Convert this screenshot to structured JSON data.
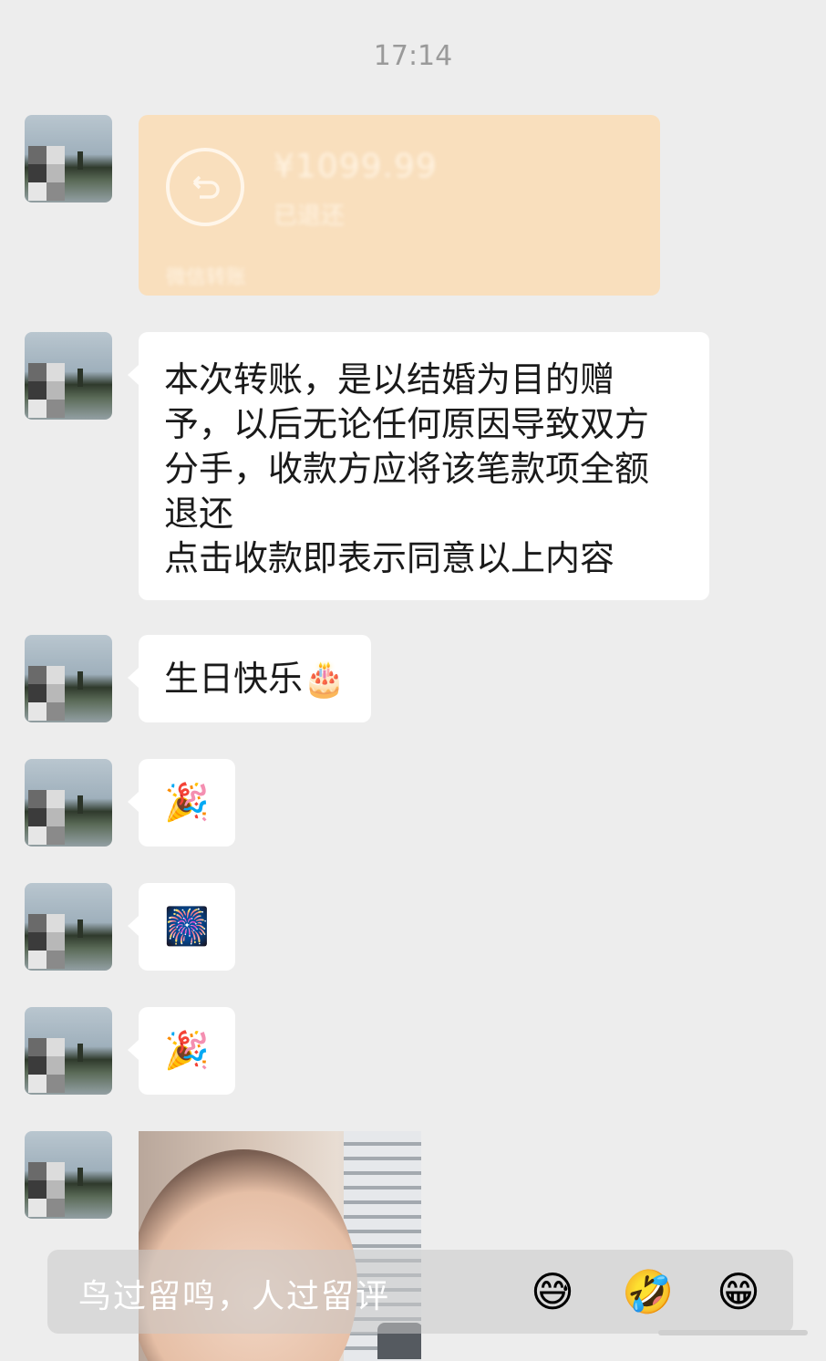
{
  "timestamp": "17:14",
  "transfer": {
    "amount": "¥1099.99",
    "status": "已退还",
    "footer": "微信转账",
    "color": "#f9dfbd"
  },
  "messages": {
    "text_lines": [
      "本次转账，是以结婚为目的赠",
      "予，以后无论任何原因导致双方",
      "分手，收款方应将该笔款项全额",
      "退还",
      "点击收款即表示同意以上内容"
    ],
    "birthday": "生日快乐🎂",
    "emoji_1": "🎉",
    "emoji_2": "🎆",
    "emoji_3": "🎉"
  },
  "comment_bar": {
    "placeholder": "鸟过留鸣，人过留评",
    "emoji_sweat_smile": "😅",
    "emoji_rofl": "🤣",
    "emoji_grin": "😁"
  }
}
